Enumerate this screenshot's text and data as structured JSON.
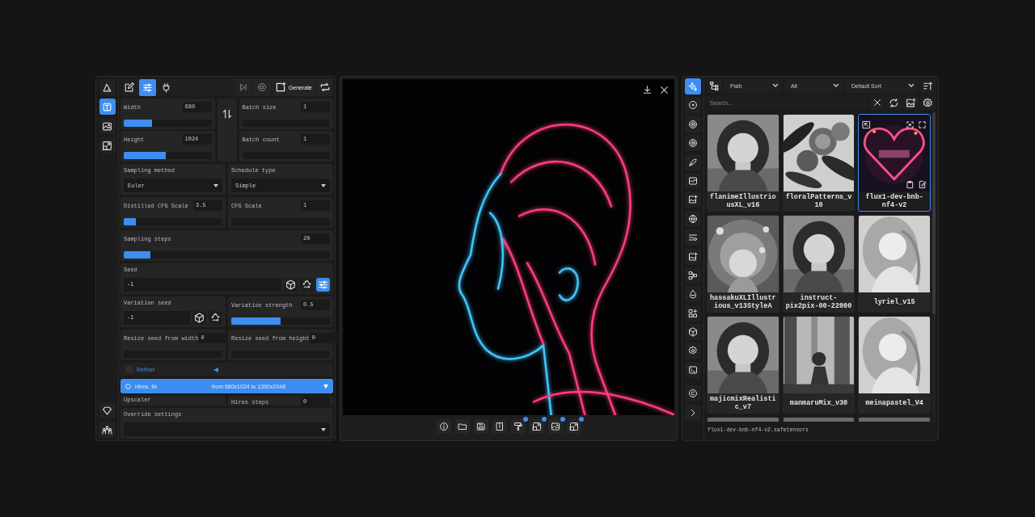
{
  "left_panel": {
    "nav": [
      {
        "selected": false
      },
      {
        "selected": true
      },
      {
        "selected": false
      },
      {
        "selected": false
      }
    ],
    "tabs": [
      {
        "selected": false
      },
      {
        "selected": true
      },
      {
        "selected": false
      }
    ],
    "generate": "Generate",
    "rows": [
      {
        "kind": "size",
        "cells": [
          {
            "kind": "slider",
            "label": "Width",
            "value": "680",
            "level": 0.32
          },
          {
            "kind": "slider",
            "label": "Height",
            "value": "1024",
            "level": 0.48
          },
          {
            "kind": "slider",
            "label": "Batch size",
            "value": "1"
          },
          {
            "kind": "slider",
            "label": "Batch count",
            "value": "1"
          }
        ]
      },
      {
        "kind": "pair",
        "cells": [
          {
            "kind": "select",
            "label": "Sampling method",
            "value": "Euler"
          },
          {
            "kind": "select",
            "label": "Schedule type",
            "value": "Simple"
          }
        ]
      },
      {
        "kind": "pair",
        "cells": [
          {
            "kind": "slider",
            "label": "Distilled CFG Scale",
            "value": "3.5",
            "level": 0.12
          },
          {
            "kind": "slider",
            "label": "CFG Scale",
            "value": "1"
          }
        ]
      },
      {
        "kind": "single",
        "cells": [
          {
            "kind": "slider",
            "label": "Sampling steps",
            "value": "20",
            "level": 0.13
          }
        ]
      },
      {
        "kind": "single",
        "cells": [
          {
            "kind": "seed",
            "label": "Seed",
            "value": "-1",
            "buttons": [
              {
                "selected": false
              },
              {
                "selected": false
              },
              {
                "selected": true
              }
            ]
          }
        ]
      },
      {
        "kind": "pair",
        "cells": [
          {
            "kind": "seed",
            "label": "Variation seed",
            "value": "-1",
            "buttons": [
              {
                "selected": false
              },
              {
                "selected": false
              }
            ]
          },
          {
            "kind": "slider",
            "label": "Variation strength",
            "value": "0.5",
            "level": 0.5
          }
        ]
      },
      {
        "kind": "pair",
        "cells": [
          {
            "kind": "slider",
            "label": "Resize seed from width",
            "value": "0"
          },
          {
            "kind": "slider",
            "label": "Resize seed from height",
            "value": "0"
          }
        ]
      },
      {
        "kind": "accordion",
        "label": "Refiner",
        "checked": false,
        "expanded": false
      },
      {
        "kind": "accordion",
        "label": "Hires. fix",
        "info": "from 680x1024 to 1360x2048",
        "expanded": true
      },
      {
        "kind": "clipped",
        "cells": [
          {
            "kind": "label",
            "label": "Upscaler"
          },
          {
            "kind": "slider",
            "label": "Hires steps",
            "value": "0"
          }
        ]
      },
      {
        "kind": "single",
        "cells": [
          {
            "kind": "select",
            "label": "Override settings"
          }
        ]
      }
    ]
  },
  "viewer": {
    "toolbar": [
      {
        "badge": false
      },
      {
        "badge": false
      },
      {
        "badge": false
      },
      {
        "badge": false
      },
      {
        "badge": true
      },
      {
        "badge": true
      },
      {
        "badge": true
      },
      {
        "badge": true
      }
    ]
  },
  "browser": {
    "side": [
      {
        "selected": true
      },
      {
        "selected": false
      },
      {
        "selected": false
      },
      {
        "selected": false
      },
      {
        "selected": false
      },
      {
        "selected": false
      },
      {
        "selected": false
      },
      {
        "selected": false
      },
      {
        "selected": false
      },
      {
        "selected": false
      },
      {
        "selected": false
      },
      {
        "selected": false
      },
      {
        "selected": false
      },
      {
        "selected": false
      },
      {
        "selected": false
      },
      {
        "selected": false
      },
      {
        "selected": false
      },
      {
        "selected": false
      }
    ],
    "filters": [
      {
        "value": "Path"
      },
      {
        "value": "All"
      },
      {
        "value": "Default Sort"
      }
    ],
    "search": {
      "placeholder": "Search..."
    },
    "cards": [
      {
        "name": "flanimeIllustriousXL_v16",
        "selected": false
      },
      {
        "name": "floralPatterns_v10",
        "selected": false
      },
      {
        "name": "flux1-dev-bnb-nf4-v2",
        "selected": true
      },
      {
        "name": "hassakuXLIllustrious_v13StyleA",
        "selected": false
      },
      {
        "name": "instruct-pix2pix-00-22000",
        "selected": false
      },
      {
        "name": "lyriel_v15",
        "selected": false
      },
      {
        "name": "majicmixRealistic_v7",
        "selected": false
      },
      {
        "name": "manmaruMix_v30",
        "selected": false
      },
      {
        "name": "meinapastel_V4",
        "selected": false
      },
      {
        "kind": "picture"
      },
      {
        "kind": "picture"
      },
      {
        "kind": "picture"
      }
    ],
    "status": "flux1-dev-bnb-nf4-v2.safetensors"
  }
}
